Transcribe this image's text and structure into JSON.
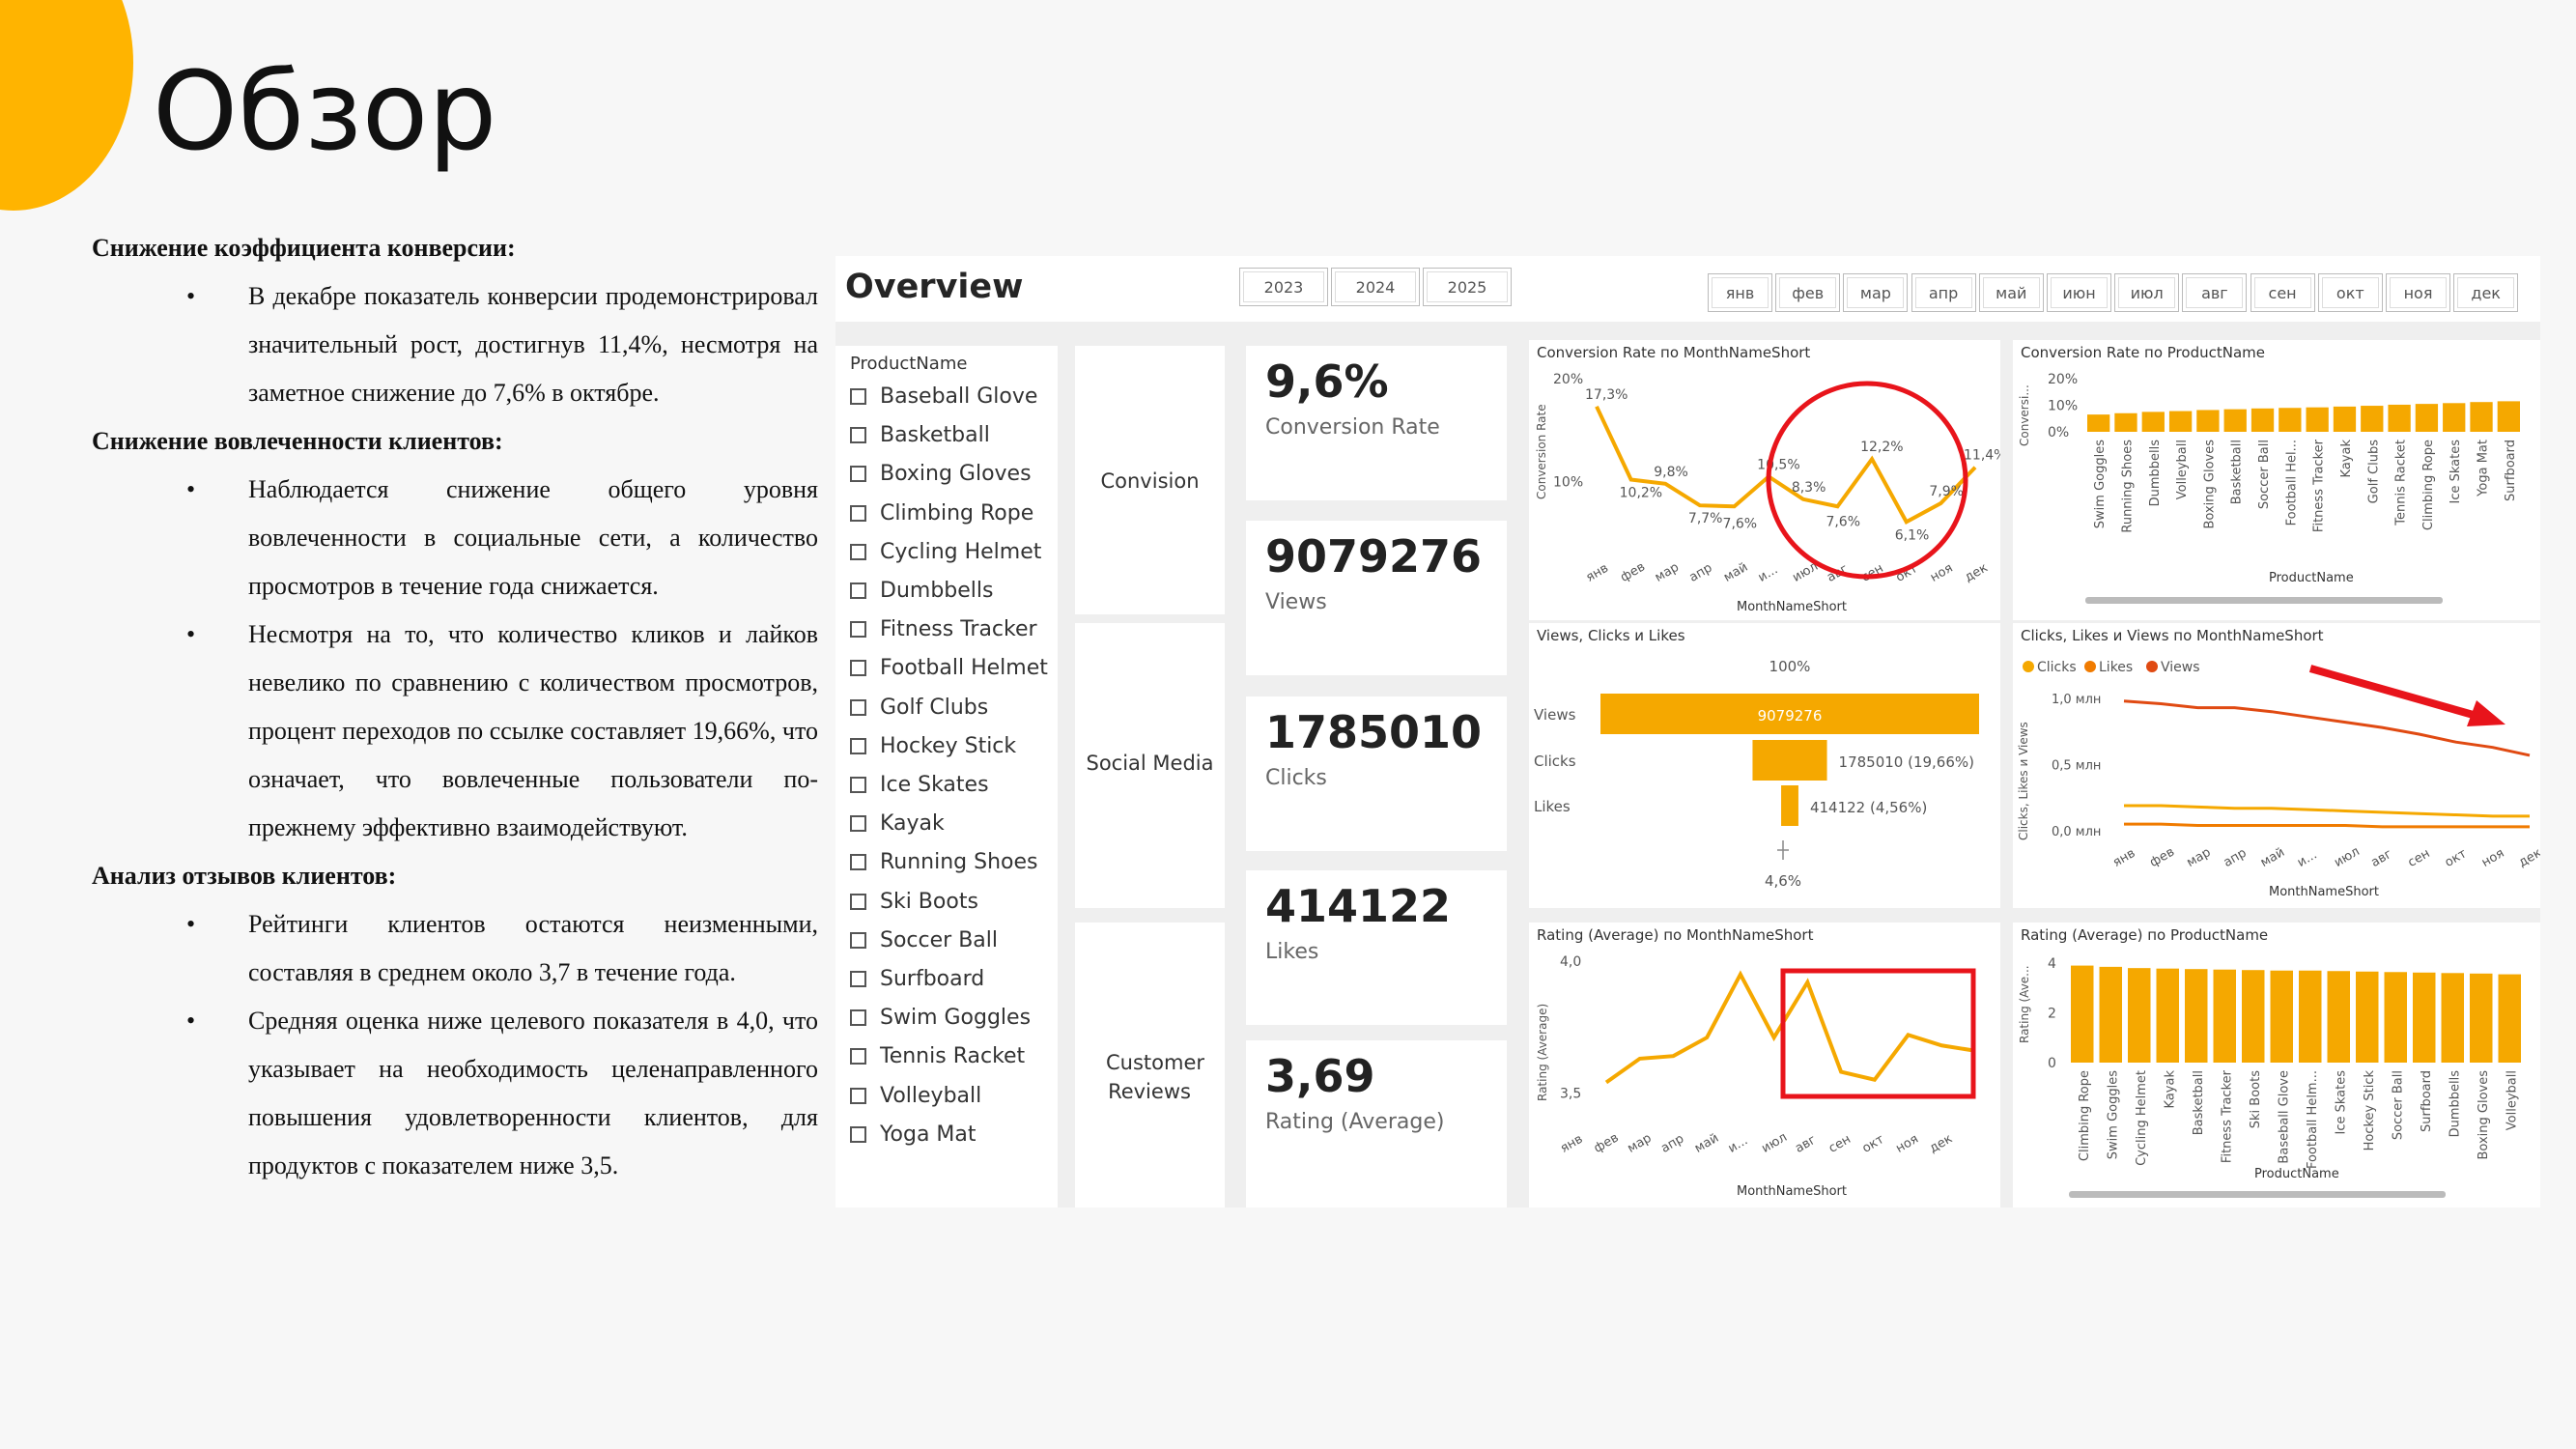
{
  "slide": {
    "title": "Обзор",
    "sections": [
      {
        "heading": "Снижение коэффициента конверсии:",
        "bullets": [
          "В декабре показатель конверсии продемонстрировал значительный рост, достигнув 11,4%, несмотря на заметное снижение до 7,6% в октябре."
        ]
      },
      {
        "heading": "Снижение вовлеченности клиентов:",
        "bullets": [
          "Наблюдается снижение общего уровня вовлеченности в социальные сети, а количество просмотров в течение года снижается.",
          "Несмотря на то, что количество кликов и лайков невелико по сравнению с количеством просмотров, процент переходов по ссылке составляет 19,66%, что означает, что вовлеченные пользователи по-прежнему эффективно взаимодействуют."
        ]
      },
      {
        "heading": "Анализ отзывов клиентов:",
        "bullets": [
          "Рейтинги клиентов остаются неизменными, составляя в среднем около 3,7 в течение года.",
          "Средняя оценка ниже целевого показателя в 4,0, что указывает на необходимость целенаправленного повышения удовлетворенности клиентов, для продуктов с показателем ниже 3,5."
        ]
      }
    ]
  },
  "dashboard": {
    "title": "Overview",
    "years": [
      "2023",
      "2024",
      "2025"
    ],
    "months": [
      "янв",
      "фев",
      "мар",
      "апр",
      "май",
      "июн",
      "июл",
      "авг",
      "сен",
      "окт",
      "ноя",
      "дек"
    ],
    "product_filter": {
      "title": "ProductName",
      "items": [
        "Baseball Glove",
        "Basketball",
        "Boxing Gloves",
        "Climbing Rope",
        "Cycling Helmet",
        "Dumbbells",
        "Fitness Tracker",
        "Football Helmet",
        "Golf Clubs",
        "Hockey Stick",
        "Ice Skates",
        "Kayak",
        "Running Shoes",
        "Ski Boots",
        "Soccer Ball",
        "Surfboard",
        "Swim Goggles",
        "Tennis Racket",
        "Volleyball",
        "Yoga Mat"
      ]
    },
    "groups": [
      "Convision",
      "Social Media",
      "Customer Reviews"
    ],
    "kpis": [
      {
        "value": "9,6%",
        "label": "Conversion Rate"
      },
      {
        "value": "9079276",
        "label": "Views"
      },
      {
        "value": "1785010",
        "label": "Clicks"
      },
      {
        "value": "414122",
        "label": "Likes"
      },
      {
        "value": "3,69",
        "label": "Rating (Average)"
      }
    ],
    "accent_color": "#F5A800",
    "highlight_color": "#E8141B"
  },
  "chart_data": [
    {
      "id": "cr_month",
      "type": "line",
      "title": "Conversion Rate по MonthNameShort",
      "xlabel": "MonthNameShort",
      "ylabel": "Conversion Rate",
      "categories": [
        "янв",
        "фев",
        "мар",
        "апр",
        "май",
        "июн",
        "июл",
        "авг",
        "сен",
        "окт",
        "ноя",
        "дек"
      ],
      "category_labels": [
        "янв",
        "фев",
        "мар",
        "апр",
        "май",
        "и...",
        "июл",
        "авг",
        "сен",
        "окт",
        "ноя",
        "дек"
      ],
      "values": [
        17.3,
        10.2,
        9.8,
        7.7,
        7.6,
        10.5,
        8.3,
        7.6,
        12.2,
        6.1,
        7.9,
        11.4
      ],
      "data_labels": [
        "17,3%",
        "10,2%",
        "9,8%",
        "7,7%",
        "7,6%",
        "10,5%",
        "8,3%",
        "7,6%",
        "12,2%",
        "6,1%",
        "7,9%",
        "11,4%"
      ],
      "y_ticks": [
        "10%",
        "20%"
      ],
      "ylim": [
        5,
        20
      ]
    },
    {
      "id": "cr_product",
      "type": "bar",
      "title": "Conversion Rate по ProductName",
      "xlabel": "ProductName",
      "ylabel": "Conversi...",
      "categories": [
        "Swim Goggles",
        "Running Shoes",
        "Dumbbells",
        "Volleyball",
        "Boxing Gloves",
        "Basketball",
        "Soccer Ball",
        "Football Hel...",
        "Fitness Tracker",
        "Kayak",
        "Golf Clubs",
        "Tennis Racket",
        "Climbing Rope",
        "Ice Skates",
        "Yoga Mat",
        "Surfboard"
      ],
      "values": [
        6.5,
        7.0,
        7.5,
        7.8,
        8.2,
        8.5,
        8.8,
        9.0,
        9.2,
        9.5,
        9.8,
        10.2,
        10.5,
        10.8,
        11.2,
        11.5
      ],
      "y_ticks": [
        "0%",
        "10%",
        "20%"
      ],
      "ylim": [
        0,
        20
      ]
    },
    {
      "id": "funnel",
      "type": "bar",
      "title": "Views, Clicks и Likes",
      "top_label": "100%",
      "bottom_label": "4,6%",
      "categories": [
        "Views",
        "Clicks",
        "Likes"
      ],
      "values": [
        9079276,
        1785010,
        414122
      ],
      "data_labels": [
        "9079276",
        "1785010 (19,66%)",
        "414122 (4,56%)"
      ]
    },
    {
      "id": "engagement_month",
      "type": "line",
      "title": "Clicks, Likes и Views по MonthNameShort",
      "xlabel": "MonthNameShort",
      "ylabel": "Clicks, Likes и Views",
      "categories": [
        "янв",
        "фев",
        "мар",
        "апр",
        "май",
        "июн",
        "июл",
        "авг",
        "сен",
        "окт",
        "ноя",
        "дек"
      ],
      "category_labels": [
        "янв",
        "фев",
        "мар",
        "апр",
        "май",
        "и...",
        "июл",
        "авг",
        "сен",
        "окт",
        "ноя",
        "дек"
      ],
      "legend": [
        "Clicks",
        "Likes",
        "Views"
      ],
      "series": [
        {
          "name": "Clicks",
          "color": "#F5A800",
          "values": [
            0.19,
            0.19,
            0.18,
            0.17,
            0.17,
            0.16,
            0.15,
            0.14,
            0.13,
            0.12,
            0.11,
            0.11
          ]
        },
        {
          "name": "Likes",
          "color": "#F07B00",
          "values": [
            0.05,
            0.05,
            0.04,
            0.04,
            0.04,
            0.04,
            0.04,
            0.03,
            0.03,
            0.03,
            0.03,
            0.03
          ]
        },
        {
          "name": "Views",
          "color": "#E04A12",
          "values": [
            0.98,
            0.96,
            0.93,
            0.93,
            0.9,
            0.86,
            0.82,
            0.78,
            0.73,
            0.67,
            0.63,
            0.57
          ]
        }
      ],
      "y_ticks": [
        "0,0 млн",
        "0,5 млн",
        "1,0 млн"
      ],
      "ylim": [
        0,
        1.0
      ]
    },
    {
      "id": "rating_month",
      "type": "line",
      "title": "Rating (Average) по MonthNameShort",
      "xlabel": "MonthNameShort",
      "ylabel": "Rating (Average)",
      "categories": [
        "янв",
        "фев",
        "мар",
        "апр",
        "май",
        "июн",
        "июл",
        "авг",
        "сен",
        "окт",
        "ноя",
        "дек"
      ],
      "category_labels": [
        "янв",
        "фев",
        "мар",
        "апр",
        "май",
        "и...",
        "июл",
        "авг",
        "сен",
        "окт",
        "ноя",
        "дек"
      ],
      "values": [
        3.54,
        3.63,
        3.64,
        3.71,
        3.95,
        3.71,
        3.92,
        3.58,
        3.55,
        3.72,
        3.68,
        3.66
      ],
      "y_ticks": [
        "3,5",
        "4,0"
      ],
      "ylim": [
        3.45,
        4.0
      ]
    },
    {
      "id": "rating_product",
      "type": "bar",
      "title": "Rating (Average) по ProductName",
      "xlabel": "ProductName",
      "ylabel": "Rating (Ave...",
      "categories": [
        "Climbing Rope",
        "Swim Goggles",
        "Cycling Helmet",
        "Kayak",
        "Basketball",
        "Fitness Tracker",
        "Ski Boots",
        "Baseball Glove",
        "Football Helm...",
        "Ice Skates",
        "Hockey Stick",
        "Soccer Ball",
        "Surfboard",
        "Dumbbells",
        "Boxing Gloves",
        "Volleyball"
      ],
      "values": [
        3.9,
        3.85,
        3.8,
        3.78,
        3.76,
        3.74,
        3.72,
        3.7,
        3.7,
        3.68,
        3.66,
        3.64,
        3.62,
        3.6,
        3.58,
        3.55
      ],
      "y_ticks": [
        "0",
        "2",
        "4"
      ],
      "ylim": [
        0,
        4
      ]
    }
  ]
}
